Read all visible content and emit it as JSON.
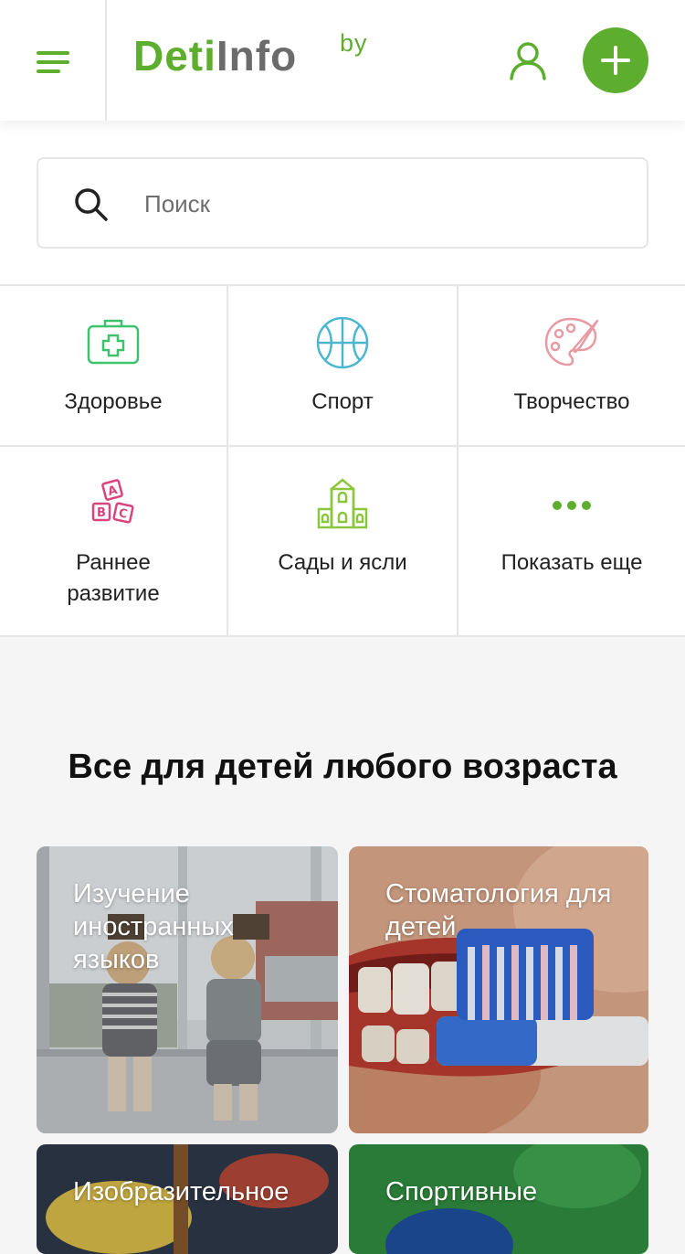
{
  "header": {
    "logo": {
      "main": "Deti",
      "accent": "Info",
      "suffix": "by"
    }
  },
  "search": {
    "placeholder": "Поиск",
    "value": ""
  },
  "categories": [
    {
      "label": "Здоровье",
      "icon": "first-aid-kit-icon",
      "color": "#3ec26b"
    },
    {
      "label": "Спорт",
      "icon": "basketball-icon",
      "color": "#4bb6d0"
    },
    {
      "label": "Творчество",
      "icon": "palette-icon",
      "color": "#e89aa3"
    },
    {
      "label": "Раннее\nразвитие",
      "icon": "abc-blocks-icon",
      "color": "#d9457e"
    },
    {
      "label": "Сады и ясли",
      "icon": "kindergarten-building-icon",
      "color": "#8cc63f"
    },
    {
      "label": "Показать еще",
      "icon": "more-dots-icon",
      "color": "#5dae2f"
    }
  ],
  "section": {
    "title": "Все для детей любого возраста"
  },
  "cards": [
    {
      "title": "Изучение иностранных языков"
    },
    {
      "title": "Стоматология для детей"
    },
    {
      "title": "Изобразительное"
    },
    {
      "title": "Спортивные"
    }
  ],
  "colors": {
    "brand_green": "#5dae2f",
    "logo_gray": "#6b6b6b",
    "divider": "#e6e6e6",
    "page_bg": "#f5f5f5"
  }
}
